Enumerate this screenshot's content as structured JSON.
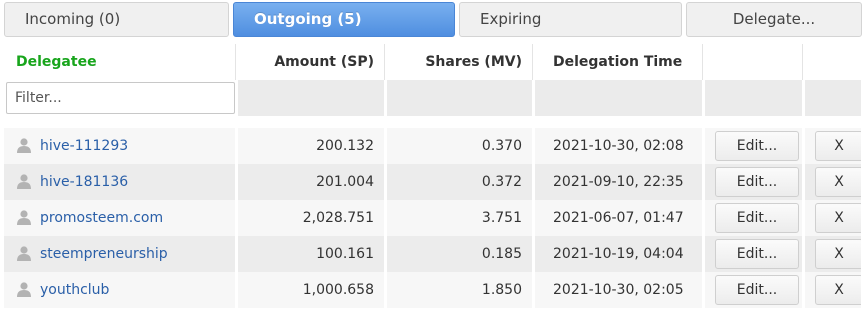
{
  "tabs": {
    "incoming": "Incoming (0)",
    "outgoing": "Outgoing (5)",
    "expiring": "Expiring",
    "delegate": "Delegate..."
  },
  "table": {
    "headers": [
      "Delegatee",
      "Amount (SP)",
      "Shares (MV)",
      "Delegation Time"
    ],
    "filter_placeholder": "Filter...",
    "edit_label": "Edit...",
    "remove_label": "X",
    "rows": [
      {
        "delegatee": "hive-111293",
        "amount": "200.132",
        "shares": "0.370",
        "time": "2021-10-30, 02:08"
      },
      {
        "delegatee": "hive-181136",
        "amount": "201.004",
        "shares": "0.372",
        "time": "2021-09-10, 22:35"
      },
      {
        "delegatee": "promosteem.com",
        "amount": "2,028.751",
        "shares": "3.751",
        "time": "2021-06-07, 01:47"
      },
      {
        "delegatee": "steempreneurship",
        "amount": "100.161",
        "shares": "0.185",
        "time": "2021-10-19, 04:04"
      },
      {
        "delegatee": "youthclub",
        "amount": "1,000.658",
        "shares": "1.850",
        "time": "2021-10-30, 02:05"
      }
    ]
  },
  "colors": {
    "active_tab": "#5a97e6",
    "delegatee_header": "#18a51c",
    "link": "#2a5fa8"
  }
}
